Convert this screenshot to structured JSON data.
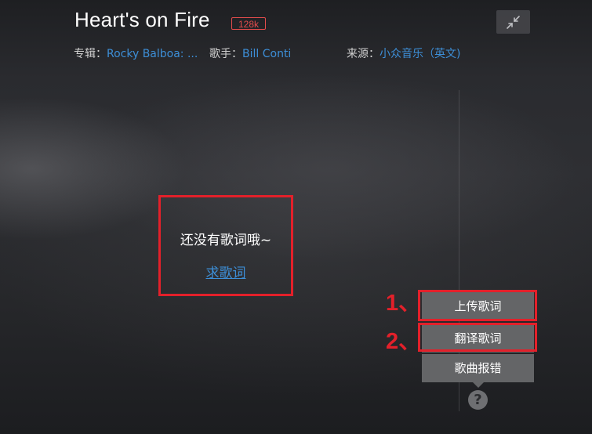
{
  "song": {
    "title": "Heart's on Fire",
    "quality": "128k"
  },
  "meta": {
    "album_label": "专辑：",
    "album_value": "Rocky Balboa: ...",
    "singer_label": "歌手：",
    "singer_value": "Bill Conti",
    "source_label": "来源：",
    "source_value": "小众音乐（英文)"
  },
  "lyrics": {
    "empty_text": "还没有歌词哦~",
    "request_link": "求歌词"
  },
  "actions": {
    "upload": "上传歌词",
    "translate": "翻译歌词",
    "report": "歌曲报错"
  },
  "annotations": {
    "step1": "1、",
    "step2": "2、"
  },
  "icons": {
    "collapse": "collapse-icon",
    "help": "help-icon"
  },
  "help_glyph": "?",
  "colors": {
    "link": "#3d8fd8",
    "highlight": "#e3202a",
    "quality": "#e34c4c",
    "button_bg": "#646567"
  }
}
